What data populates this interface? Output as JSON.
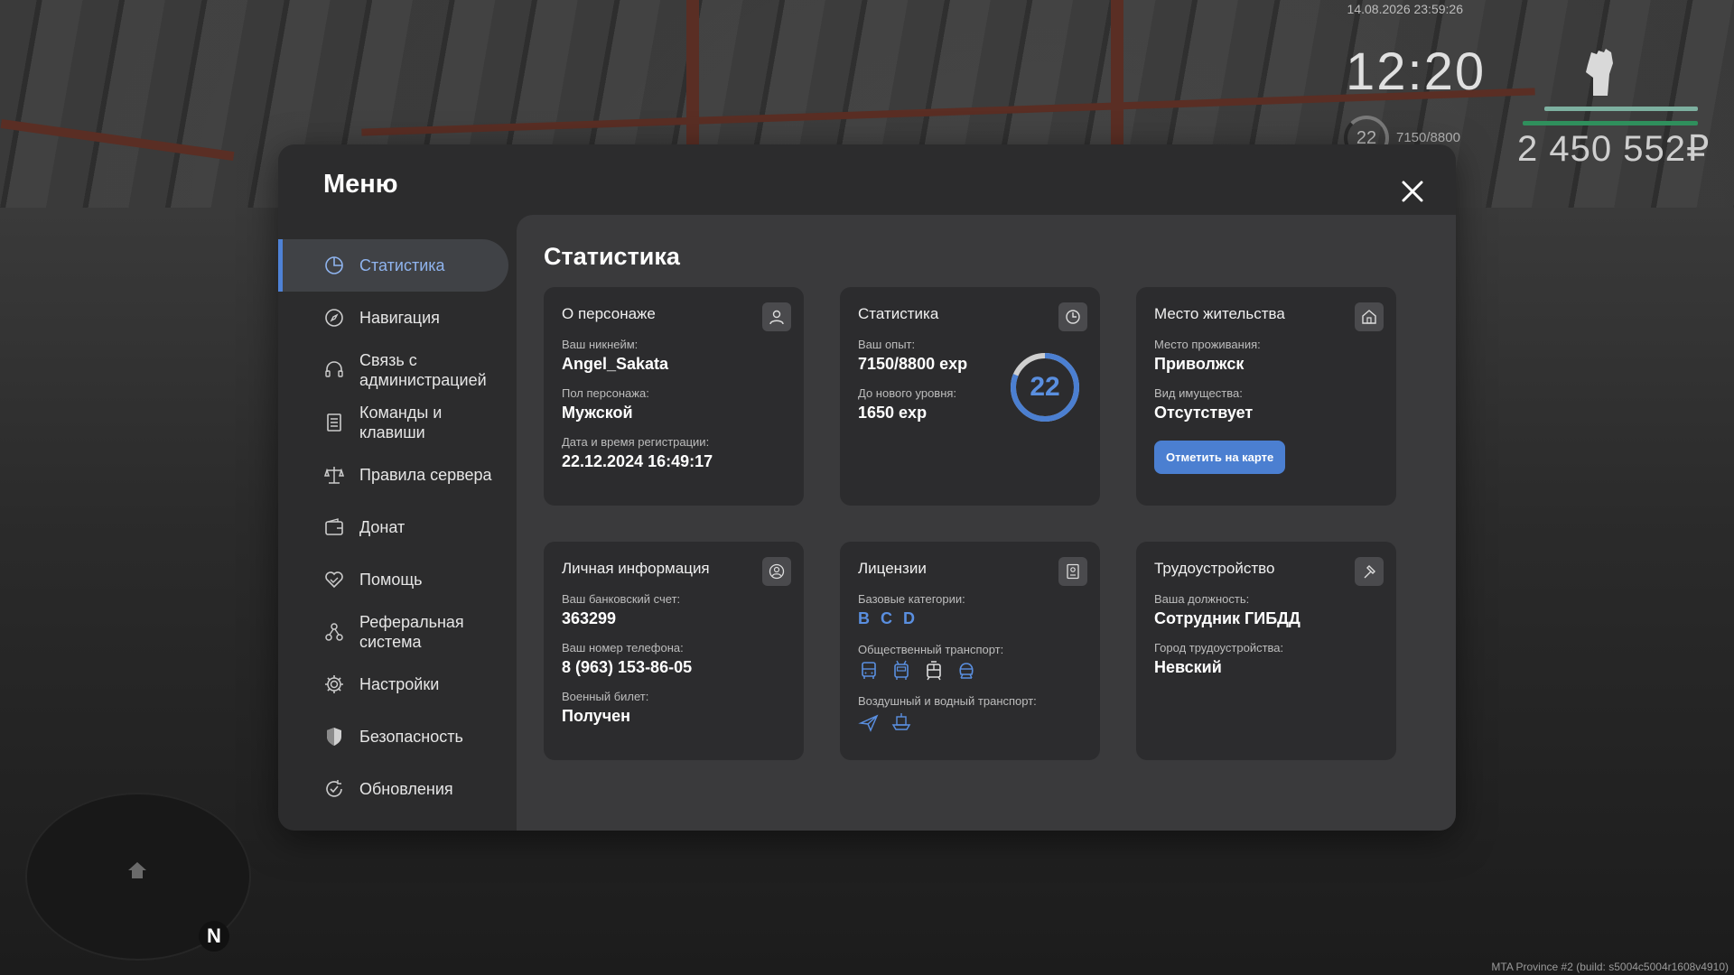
{
  "hud": {
    "datetime": "14.08.2026 23:59:26",
    "clock": "12:20",
    "level": "22",
    "xp": "7150/8800",
    "money": "2 450 552₽",
    "build": "MTA Province #2 (build: s5004c5004r1608v4910)",
    "minimap_north": "N"
  },
  "menu": {
    "title": "Меню",
    "sidebar": [
      {
        "label": "Статистика",
        "icon": "pie-chart-icon"
      },
      {
        "label": "Навигация",
        "icon": "compass-icon"
      },
      {
        "label": "Связь с администрацией",
        "icon": "headset-icon"
      },
      {
        "label": "Команды и клавиши",
        "icon": "document-list-icon"
      },
      {
        "label": "Правила сервера",
        "icon": "scales-icon"
      },
      {
        "label": "Донат",
        "icon": "wallet-icon"
      },
      {
        "label": "Помощь",
        "icon": "heart-handshake-icon"
      },
      {
        "label": "Реферальная система",
        "icon": "network-icon"
      },
      {
        "label": "Настройки",
        "icon": "gear-icon"
      },
      {
        "label": "Безопасность",
        "icon": "shield-icon"
      },
      {
        "label": "Обновления",
        "icon": "refresh-check-icon"
      }
    ],
    "active_index": 0
  },
  "content": {
    "title": "Статистика",
    "character": {
      "title": "О персонаже",
      "nick_label": "Ваш никнейм:",
      "nick": "Angel_Sakata",
      "gender_label": "Пол персонажа:",
      "gender": "Мужской",
      "reg_label": "Дата и время регистрации:",
      "reg": "22.12.2024 16:49:17"
    },
    "stats": {
      "title": "Статистика",
      "exp_label": "Ваш опыт:",
      "exp": "7150/8800 exp",
      "next_label": "До нового уровня:",
      "next": "1650 exp",
      "level": "22",
      "progress": 0.8125
    },
    "residence": {
      "title": "Место жительства",
      "place_label": "Место проживания:",
      "place": "Приволжск",
      "property_label": "Вид имущества:",
      "property": "Отсутствует",
      "button": "Отметить на карте"
    },
    "personal": {
      "title": "Личная информация",
      "bank_label": "Ваш банковский счет:",
      "bank": "363299",
      "phone_label": "Ваш номер телефона:",
      "phone": "8 (963) 153-86-05",
      "military_label": "Военный билет:",
      "military": "Получен"
    },
    "licenses": {
      "title": "Лицензии",
      "base_label": "Базовые категории:",
      "categories": [
        "B",
        "C",
        "D"
      ],
      "public_label": "Общественный транспорт:",
      "public_icons": [
        "bus-icon",
        "trolleybus-icon",
        "tram-icon",
        "train-icon"
      ],
      "air_label": "Воздушный и водный транспорт:",
      "air_icons": [
        "plane-icon",
        "boat-icon"
      ]
    },
    "employment": {
      "title": "Трудоустройство",
      "position_label": "Ваша должность:",
      "position": "Сотрудник ГИБДД",
      "city_label": "Город трудоустройства:",
      "city": "Невский"
    }
  },
  "colors": {
    "accent": "#4b7fd1",
    "panel": "#2c2c2d",
    "content": "#3a3a3c",
    "hud_health": "#2f8f5c",
    "hud_armor": "#7db0a0"
  }
}
